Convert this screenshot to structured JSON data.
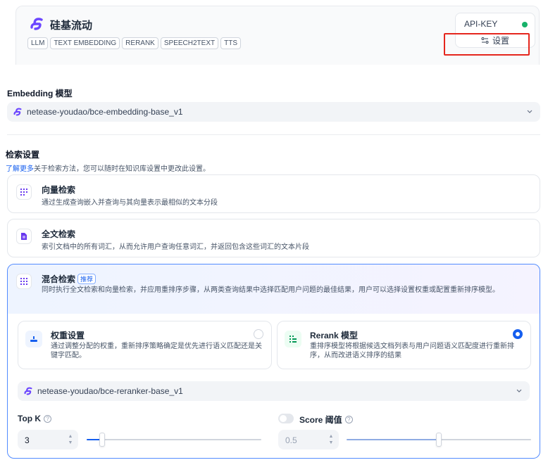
{
  "provider": {
    "name": "硅基流动",
    "tags": [
      "LLM",
      "TEXT EMBEDDING",
      "RERANK",
      "SPEECH2TEXT",
      "TTS"
    ],
    "api_key_label": "API-KEY",
    "api_key_status_color": "#17b26a",
    "settings_label": "设置"
  },
  "embedding": {
    "title": "Embedding 模型",
    "selected_model": "netease-youdao/bce-embedding-base_v1"
  },
  "retrieval": {
    "title": "检索设置",
    "learn_more": "了解更多",
    "description": "关于检索方法，您可以随时在知识库设置中更改此设置。",
    "methods": {
      "vector": {
        "title": "向量检索",
        "description": "通过生成查询嵌入并查询与其向量表示最相似的文本分段"
      },
      "fulltext": {
        "title": "全文检索",
        "description": "索引文档中的所有词汇，从而允许用户查询任意词汇，并返回包含这些词汇的文本片段"
      },
      "hybrid": {
        "title": "混合检索",
        "badge": "推荐",
        "description": "同时执行全文检索和向量检索，并应用重排序步骤，从两类查询结果中选择匹配用户问题的最佳结果，用户可以选择设置权重或配置重新排序模型。"
      }
    },
    "weight_setting": {
      "title": "权重设置",
      "description": "通过调整分配的权重，重新排序策略确定是优先进行语义匹配还是关键字匹配。",
      "selected": false
    },
    "rerank_model": {
      "title": "Rerank 模型",
      "description": "重排序模型将根据候选文档列表与用户问题语义匹配度进行重新排序，从而改进语义排序的结果",
      "selected": true
    },
    "rerank_selected_model": "netease-youdao/bce-reranker-base_v1",
    "top_k": {
      "label": "Top K",
      "value": "3",
      "slider_fraction": 0.09
    },
    "score_threshold": {
      "label": "Score 阈值",
      "value": "0.5",
      "enabled": false,
      "slider_fraction": 0.5
    }
  },
  "colors": {
    "accent": "#155eef",
    "highlight_box": "#e5261d",
    "brand_purple": "#6c47ff"
  }
}
